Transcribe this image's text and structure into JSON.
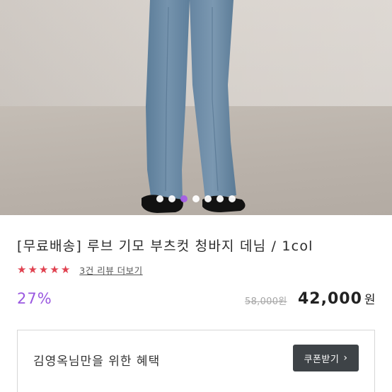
{
  "gallery": {
    "slide_count": 7,
    "active_index": 2
  },
  "product": {
    "title": "[무료배송] 루브 기모 부츠컷 청바지 데님 / 1col",
    "rating_stars": 5,
    "review_link": "3건 리뷰 더보기",
    "discount": "27%",
    "original_price": "58,000원",
    "price": "42,000",
    "currency": "원"
  },
  "benefit": {
    "text": "김영옥님만을 위한 혜택",
    "coupon_button": "쿠폰받기"
  },
  "colors": {
    "accent_purple": "#9a58e0",
    "star_red": "#e0414f",
    "button_dark": "#3e4347"
  },
  "icons": {
    "star": "star-icon",
    "chevron": "chevron-right-icon"
  }
}
